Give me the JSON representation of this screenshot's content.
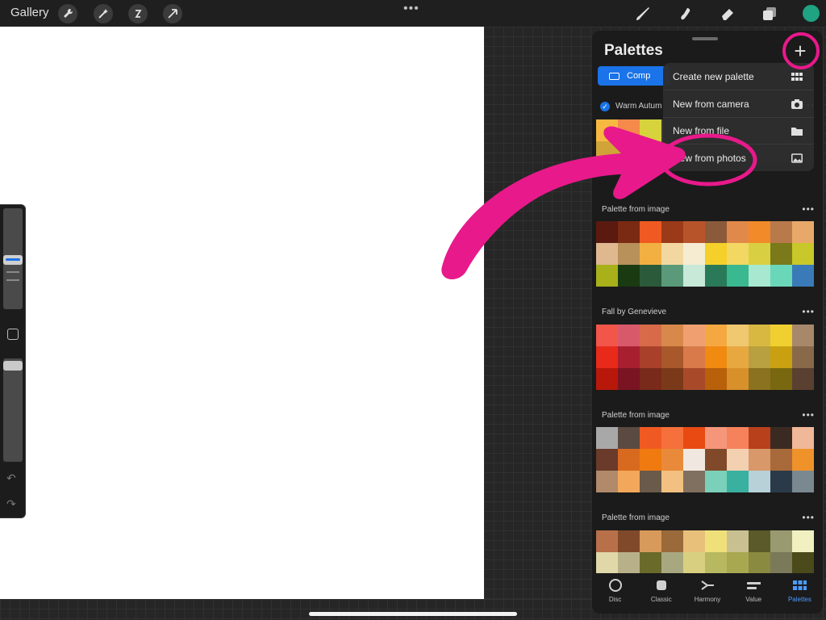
{
  "topbar": {
    "gallery_label": "Gallery",
    "menu_dots": "•••",
    "accent_color": "#1fa383"
  },
  "panel": {
    "title": "Palettes",
    "add_icon": "+",
    "segment_label": "Comp",
    "dropdown": [
      {
        "label": "Create new palette",
        "icon": "grid-icon"
      },
      {
        "label": "New from camera",
        "icon": "camera-icon"
      },
      {
        "label": "New from file",
        "icon": "folder-icon"
      },
      {
        "label": "New from photos",
        "icon": "photo-icon"
      }
    ],
    "palettes": [
      {
        "name": "Warm Autum",
        "checked": true,
        "menu": "•••",
        "rows": [
          [
            "#f7b842",
            "#f58a4a",
            "#d7d33c",
            "#3a3a3a",
            "#3a3a3a",
            "#3a3a3a",
            "#3a3a3a",
            "#3a3a3a",
            "#3a3a3a",
            "#3a3a3a"
          ],
          [
            "#d1a43a",
            "#b8b22e",
            "#a9c13b",
            "#3a3a3a",
            "#3a3a3a",
            "#3a3a3a",
            "#3a3a3a",
            "#3a3a3a",
            "#3a3a3a",
            "#3a3a3a"
          ]
        ]
      },
      {
        "name": "Palette from image",
        "menu": "•••",
        "rows": [
          [
            "#5a1a10",
            "#7a2a12",
            "#f05a22",
            "#9a3a18",
            "#b8542a",
            "#8a5a3a",
            "#e0894a",
            "#f28a2a",
            "#b87a4a",
            "#e8a86a"
          ],
          [
            "#e0b890",
            "#b8905a",
            "#f2b042",
            "#f2d8a0",
            "#f5ecd2",
            "#f5d02a",
            "#f2d862",
            "#d8d042",
            "#7a7a1a",
            "#c8c82a"
          ],
          [
            "#a8b01a",
            "#1a3a12",
            "#2a5a3a",
            "#5a9a7a",
            "#c8e8d8",
            "#2a7a5a",
            "#3ab890",
            "#a8e8d0",
            "#6ad8b8",
            "#3a7ab8"
          ]
        ]
      },
      {
        "name": "Fall by Genevieve",
        "menu": "•••",
        "rows": [
          [
            "#f2554a",
            "#d85a6a",
            "#d86a4a",
            "#d8884a",
            "#f0a070",
            "#f5a840",
            "#f0c870",
            "#d8b840",
            "#f0d030",
            "#a8886a"
          ],
          [
            "#e82a1a",
            "#a82030",
            "#a8402a",
            "#a8582a",
            "#d87a4a",
            "#f08a10",
            "#e8a840",
            "#b8a040",
            "#c8a010",
            "#886a4a"
          ],
          [
            "#b8180a",
            "#7a1422",
            "#7a2a1a",
            "#7a3a1a",
            "#a84a2a",
            "#b8600a",
            "#d8902a",
            "#8a7220",
            "#7a6810",
            "#5a4030"
          ]
        ]
      },
      {
        "name": "Palette from image",
        "menu": "•••",
        "rows": [
          [
            "#a8a8a8",
            "#5a4a40",
            "#f05a22",
            "#f5703a",
            "#e84a12",
            "#f5967a",
            "#f5825a",
            "#b8401a",
            "#3a2a22",
            "#f0b898"
          ],
          [
            "#6a3a2a",
            "#d86a20",
            "#f07a10",
            "#e88a3a",
            "#f0e8e0",
            "#804a2a",
            "#f2d0b0",
            "#d8986a",
            "#a86a3a",
            "#f0922a"
          ],
          [
            "#b08a6a",
            "#f2a85a",
            "#6a5a4a",
            "#f2c080",
            "#807060",
            "#7ad0b8",
            "#3ab0a0",
            "#b8d0d8",
            "#2a3a48",
            "#7a8890"
          ]
        ]
      },
      {
        "name": "Palette from image",
        "menu": "•••",
        "rows": [
          [
            "#b8704a",
            "#804a2a",
            "#d89a5a",
            "#9a6a3a",
            "#e8c07a",
            "#f0e07a",
            "#c8c090",
            "#5a5a2a",
            "#9a9a70",
            "#f0f0c0"
          ],
          [
            "#e0d8a8",
            "#b8b088",
            "#6a6a2a",
            "#a8a880",
            "#d8d080",
            "#b8b860",
            "#a8a850",
            "#8a8a40",
            "#7a7a5a",
            "#4a4a1a"
          ]
        ]
      }
    ],
    "tabs": [
      {
        "label": "Disc",
        "icon": "disc-icon"
      },
      {
        "label": "Classic",
        "icon": "classic-icon"
      },
      {
        "label": "Harmony",
        "icon": "harmony-icon"
      },
      {
        "label": "Value",
        "icon": "value-icon"
      },
      {
        "label": "Palettes",
        "icon": "palettes-icon",
        "active": true
      }
    ]
  },
  "annotation": {
    "highlight_color": "#e8198b"
  }
}
